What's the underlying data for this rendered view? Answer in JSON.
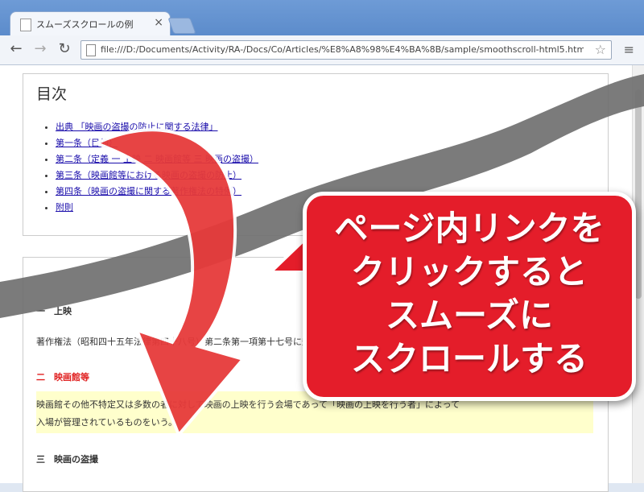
{
  "browser": {
    "tab_title": "スムーズスクロールの例",
    "tab_close": "×",
    "back": "←",
    "forward": "→",
    "reload": "↻",
    "url": "file:///D:/Documents/Activity/RA-/Docs/Co/Articles/%E8%A8%98%E4%BA%8B/sample/smoothscroll-html5.html",
    "star": "☆",
    "menu": "≡"
  },
  "toc": {
    "heading": "目次",
    "items": [
      "出典 「映画の盗撮の防止に関する法律」",
      "第一条（目的）",
      "第二条（定義 一 上映 二 映画館等 三 映画の盗撮）",
      "第三条（映画館等における映画の盗撮の防止）",
      "第四条（映画の盗撮に関する著作権法の特例）",
      "附則"
    ]
  },
  "article": {
    "section1_title": "一　上映",
    "section1_text": "著作権法（昭和四十五年法律第四十八号）第二条第一項第十七号に規定する上映をいう。",
    "section2_title": "二　映画館等",
    "section2_text_1": "映画館その他不特定又は多数の者に対して映画の上映を行う会場であって「映画の上映を行う者」によって",
    "section2_text_2": "入場が管理されているものをいう。",
    "section3_title": "三　映画の盗撮"
  },
  "callout": {
    "line1": "ページ内リンクを",
    "line2": "クリックすると",
    "line3": "スムーズに",
    "line4": "スクロールする"
  },
  "colors": {
    "callout_red": "#e41d2a",
    "arrow_red": "#e63a3a",
    "scroll_line": "#707070"
  }
}
